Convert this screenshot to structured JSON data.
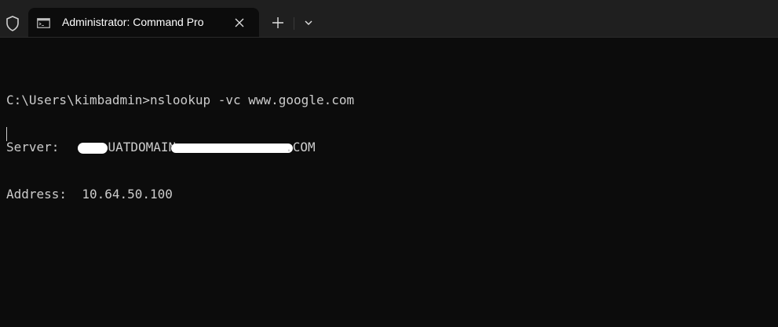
{
  "tab": {
    "title": "Administrator: Command Pro",
    "icon": "terminal-icon"
  },
  "tabbar": {
    "shield_icon": "shield-icon",
    "new_tab_icon": "plus-icon",
    "dropdown_icon": "chevron-down-icon",
    "close_icon": "close-icon"
  },
  "terminal": {
    "command_line": "C:\\Users\\kimbadmin>nslookup -vc www.google.com",
    "server_label": "Server:",
    "server_value_visible": "UATDOMAIN",
    "server_value_suffix": ".COM",
    "address_label": "Address:",
    "address_value": "10.64.50.100"
  },
  "colors": {
    "background": "#0c0c0c",
    "tabbar": "#1f1f1f",
    "text": "#cccccc"
  }
}
